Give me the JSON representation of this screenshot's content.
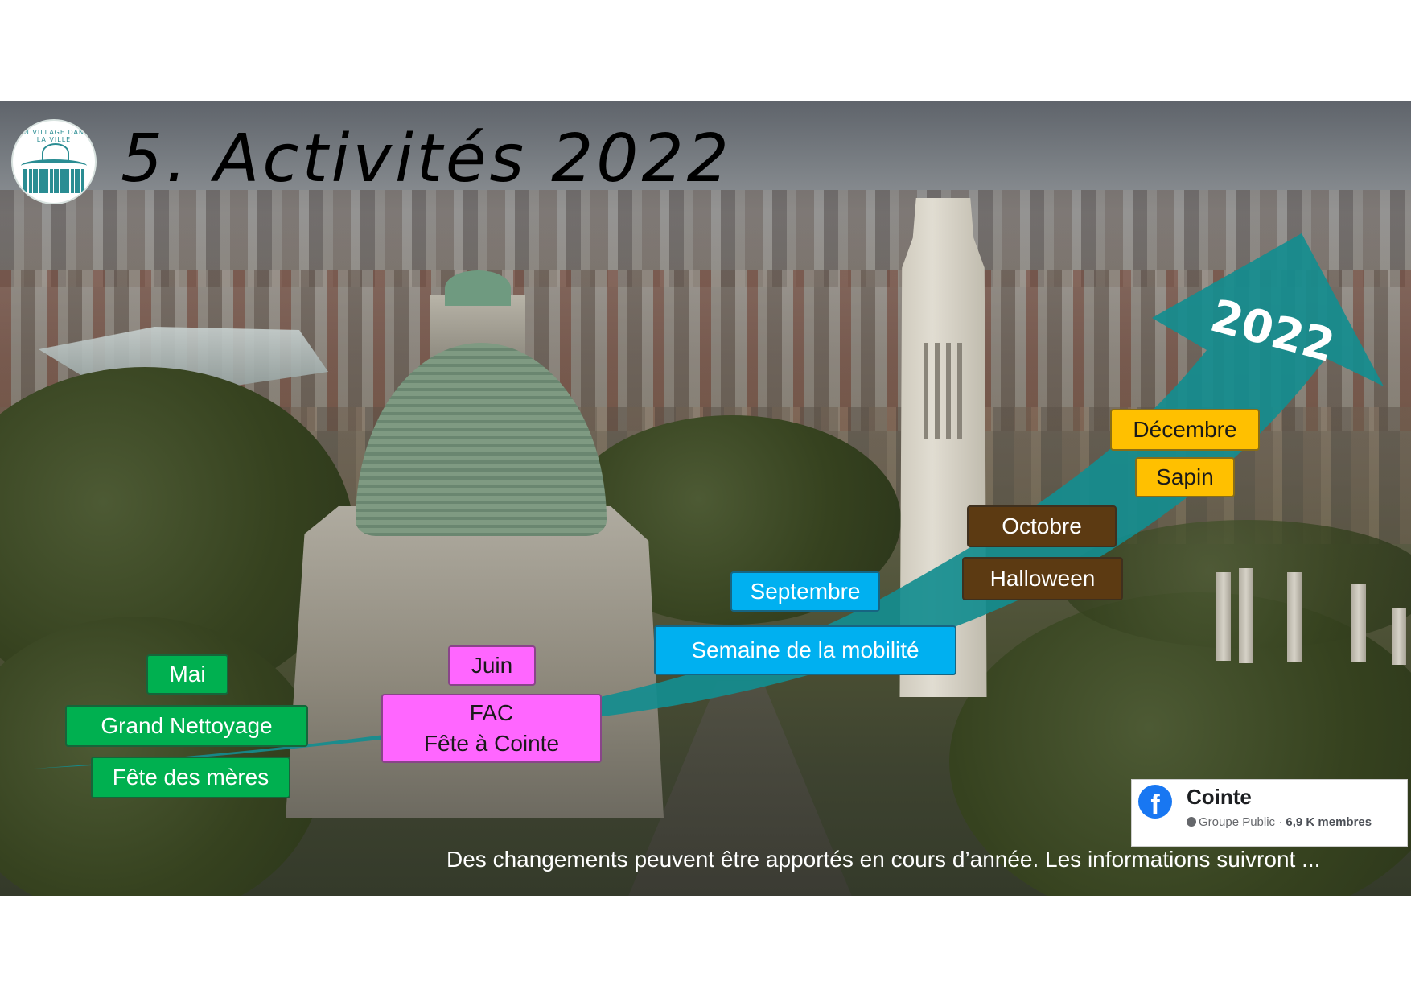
{
  "slide": {
    "title": "5. Activités 2022",
    "logo_text": "UN VILLAGE DANS LA VILLE"
  },
  "timeline": {
    "arrow_label": "2022",
    "arrow_color": "#138d8f",
    "activities": [
      {
        "id": "mai",
        "label": "Mai",
        "color": "#00b050"
      },
      {
        "id": "grand-nettoyage",
        "label": "Grand Nettoyage",
        "color": "#00b050"
      },
      {
        "id": "fete-des-meres",
        "label": "Fête des mères",
        "color": "#00b050"
      },
      {
        "id": "juin",
        "label": "Juin",
        "color": "#ff66ff"
      },
      {
        "id": "fac-line1",
        "label": "FAC",
        "color": "#ff66ff"
      },
      {
        "id": "fac-line2",
        "label": "Fête à Cointe",
        "color": "#ff66ff"
      },
      {
        "id": "septembre",
        "label": "Septembre",
        "color": "#00b0f0"
      },
      {
        "id": "semaine-mobilite",
        "label": "Semaine de la mobilité",
        "color": "#00b0f0"
      },
      {
        "id": "octobre",
        "label": "Octobre",
        "color": "#5c3a12"
      },
      {
        "id": "halloween",
        "label": "Halloween",
        "color": "#5c3a12"
      },
      {
        "id": "decembre",
        "label": "Décembre",
        "color": "#ffc000"
      },
      {
        "id": "sapin",
        "label": "Sapin",
        "color": "#ffc000"
      }
    ]
  },
  "facebook": {
    "icon": "facebook-icon",
    "group_name": "Cointe",
    "group_type": "Groupe Public · ",
    "members": "6,9 K membres"
  },
  "footer_note": "Des changements peuvent être apportés en cours d’année. Les informations suivront ..."
}
